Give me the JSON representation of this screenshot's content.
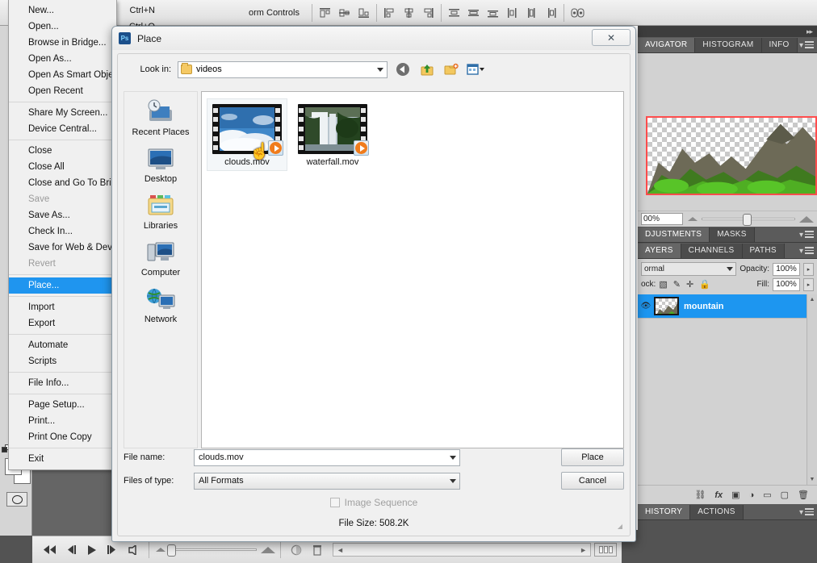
{
  "app": {
    "options_bar": {
      "label": "orm Controls",
      "align_icons": [
        "align-top-edges-icon",
        "align-vertical-centers-icon",
        "align-bottom-edges-icon",
        "align-left-edges-icon",
        "align-horizontal-centers-icon",
        "align-right-edges-icon",
        "distribute-top-edges-icon",
        "distribute-vertical-centers-icon",
        "distribute-bottom-edges-icon",
        "distribute-left-edges-icon",
        "distribute-horizontal-centers-icon",
        "distribute-right-edges-icon",
        "auto-align-layers-icon"
      ]
    }
  },
  "file_menu": {
    "items": [
      {
        "label": "New...",
        "shortcut": "Ctrl+N",
        "state": "normal"
      },
      {
        "label": "Open...",
        "shortcut": "Ctrl+O",
        "state": "normal"
      },
      {
        "label": "Browse in Bridge...",
        "shortcut": "",
        "state": "normal"
      },
      {
        "label": "Open As...",
        "shortcut": "",
        "state": "normal"
      },
      {
        "label": "Open As Smart Object...",
        "shortcut": "",
        "state": "normal"
      },
      {
        "label": "Open Recent",
        "shortcut": "",
        "state": "normal"
      },
      {
        "label": "-sep-",
        "shortcut": "",
        "state": "separator"
      },
      {
        "label": "Share My Screen...",
        "shortcut": "",
        "state": "normal"
      },
      {
        "label": "Device Central...",
        "shortcut": "",
        "state": "normal"
      },
      {
        "label": "-sep-",
        "shortcut": "",
        "state": "separator"
      },
      {
        "label": "Close",
        "shortcut": "",
        "state": "normal"
      },
      {
        "label": "Close All",
        "shortcut": "",
        "state": "normal"
      },
      {
        "label": "Close and Go To Bridge...",
        "shortcut": "",
        "state": "normal"
      },
      {
        "label": "Save",
        "shortcut": "",
        "state": "disabled"
      },
      {
        "label": "Save As...",
        "shortcut": "",
        "state": "normal"
      },
      {
        "label": "Check In...",
        "shortcut": "",
        "state": "normal"
      },
      {
        "label": "Save for Web & Devices...",
        "shortcut": "",
        "state": "normal"
      },
      {
        "label": "Revert",
        "shortcut": "",
        "state": "disabled"
      },
      {
        "label": "-sep-",
        "shortcut": "",
        "state": "separator"
      },
      {
        "label": "Place...",
        "shortcut": "",
        "state": "selected"
      },
      {
        "label": "-sep-",
        "shortcut": "",
        "state": "separator"
      },
      {
        "label": "Import",
        "shortcut": "",
        "state": "normal"
      },
      {
        "label": "Export",
        "shortcut": "",
        "state": "normal"
      },
      {
        "label": "-sep-",
        "shortcut": "",
        "state": "separator"
      },
      {
        "label": "Automate",
        "shortcut": "",
        "state": "normal"
      },
      {
        "label": "Scripts",
        "shortcut": "",
        "state": "normal"
      },
      {
        "label": "-sep-",
        "shortcut": "",
        "state": "separator"
      },
      {
        "label": "File Info...",
        "shortcut": "",
        "state": "normal"
      },
      {
        "label": "-sep-",
        "shortcut": "",
        "state": "separator"
      },
      {
        "label": "Page Setup...",
        "shortcut": "",
        "state": "normal"
      },
      {
        "label": "Print...",
        "shortcut": "",
        "state": "normal"
      },
      {
        "label": "Print One Copy",
        "shortcut": "",
        "state": "normal"
      },
      {
        "label": "-sep-",
        "shortcut": "",
        "state": "separator"
      },
      {
        "label": "Exit",
        "shortcut": "",
        "state": "normal"
      }
    ]
  },
  "place_dialog": {
    "title": "Place",
    "app_badge": "Ps",
    "close_label": "✕",
    "look_in": {
      "label": "Look in:",
      "value": "videos",
      "toolbar_icons": [
        "back-icon",
        "up-one-level-icon",
        "new-folder-icon",
        "views-icon"
      ]
    },
    "places": [
      {
        "label": "Recent Places",
        "icon": "recent-places-icon"
      },
      {
        "label": "Desktop",
        "icon": "desktop-icon"
      },
      {
        "label": "Libraries",
        "icon": "libraries-icon"
      },
      {
        "label": "Computer",
        "icon": "computer-icon"
      },
      {
        "label": "Network",
        "icon": "network-icon"
      }
    ],
    "files": [
      {
        "name": "clouds.mov",
        "selected": true,
        "kind": "movie"
      },
      {
        "name": "waterfall.mov",
        "selected": false,
        "kind": "movie"
      }
    ],
    "file_name": {
      "label": "File name:",
      "value": "clouds.mov"
    },
    "files_of_type": {
      "label": "Files of type:",
      "value": "All Formats"
    },
    "buttons": {
      "place": "Place",
      "cancel": "Cancel"
    },
    "image_sequence": {
      "label": "Image Sequence",
      "checked": false,
      "enabled": false
    },
    "file_size": "File Size: 508.2K"
  },
  "right_dock": {
    "navigator": {
      "tabs": [
        "AVIGATOR",
        "HISTOGRAM",
        "INFO"
      ],
      "active_tab": "AVIGATOR",
      "zoom_value": "00%"
    },
    "adjustments": {
      "tabs": [
        "DJUSTMENTS",
        "MASKS"
      ],
      "active_tab": "DJUSTMENTS"
    },
    "layers": {
      "tabs": [
        "AYERS",
        "CHANNELS",
        "PATHS"
      ],
      "active_tab": "AYERS",
      "blend_mode": "ormal",
      "opacity_label": "Opacity:",
      "opacity_value": "100%",
      "lock_label": "ock:",
      "lock_icons": [
        "lock-transparent-pixels-icon",
        "lock-image-pixels-icon",
        "lock-position-icon",
        "lock-all-icon"
      ],
      "fill_label": "Fill:",
      "fill_value": "100%",
      "rows": [
        {
          "name": "mountain",
          "selected": true
        }
      ],
      "footer_icons": [
        "link-layers-icon",
        "add-layer-style-icon",
        "add-layer-mask-icon",
        "new-adjustment-layer-icon",
        "new-group-icon",
        "new-layer-icon",
        "delete-layer-icon"
      ]
    },
    "history": {
      "tabs": [
        "HISTORY",
        "ACTIONS"
      ],
      "active_tab": "HISTORY"
    }
  },
  "animation_bar": {
    "buttons": [
      "select-first-frame-icon",
      "select-previous-frame-icon",
      "play-icon",
      "select-next-frame-icon",
      "audio-icon"
    ],
    "zoom_small": "small-thumbnails-icon",
    "zoom_large": "large-thumbnails-icon",
    "convert_icon": "convert-to-frame-animation-icon",
    "delete_icon": "delete-keyframes-icon"
  },
  "toolbox": {
    "foreground_color": "#ffffff",
    "background_color": "#ffffff",
    "quick_mask": "edit-in-quick-mask-mode-icon",
    "swap_icon": "swap-colors-icon",
    "default_icon": "default-colors-icon"
  },
  "colors": {
    "accent": "#1f95ef",
    "selection": "#1d96f0",
    "nav_view_box": "#ff4d4d"
  }
}
